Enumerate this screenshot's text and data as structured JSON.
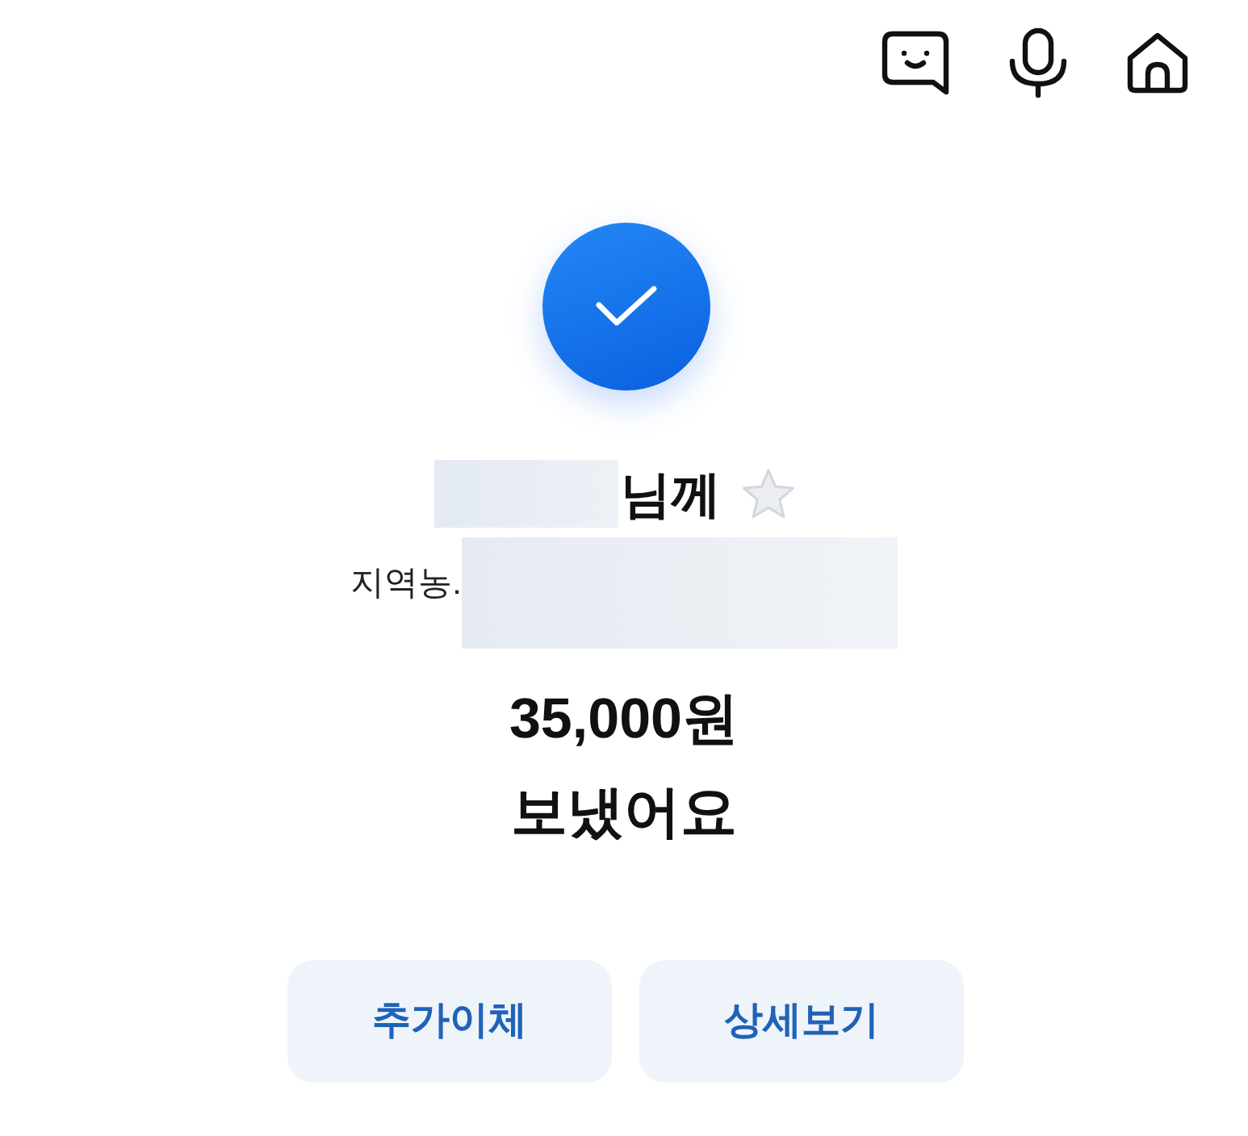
{
  "recipient": {
    "suffix": "님께",
    "favorite": false
  },
  "account": {
    "bank": "지역농."
  },
  "amount": "35,000원",
  "message": "보냈어요",
  "buttons": [
    {
      "label": "추가이체"
    },
    {
      "label": "상세보기"
    }
  ]
}
